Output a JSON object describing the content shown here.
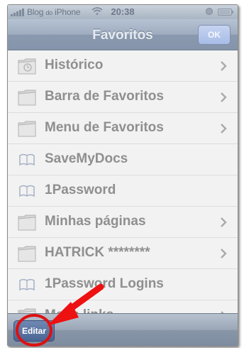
{
  "status": {
    "carrier": "Blog",
    "carrier_small": "do",
    "carrier_name": "iPhone",
    "time": "20:38"
  },
  "nav": {
    "title": "Favoritos",
    "ok_label": "OK"
  },
  "list": {
    "items": [
      {
        "label": "Histórico",
        "icon": "history-folder-icon",
        "chevron": true
      },
      {
        "label": "Barra de Favoritos",
        "icon": "folder-icon",
        "chevron": true
      },
      {
        "label": "Menu de Favoritos",
        "icon": "folder-icon",
        "chevron": true
      },
      {
        "label": "SaveMyDocs",
        "icon": "book-icon",
        "chevron": false
      },
      {
        "label": "1Password",
        "icon": "book-icon",
        "chevron": false
      },
      {
        "label": "Minhas páginas",
        "icon": "folder-icon",
        "chevron": true
      },
      {
        "label": "HATRICK ********",
        "icon": "folder-icon",
        "chevron": true
      },
      {
        "label": "1Password Logins",
        "icon": "book-icon",
        "chevron": false
      },
      {
        "label": "Meus links",
        "icon": "folder-icon",
        "chevron": true
      }
    ]
  },
  "toolbar": {
    "edit_label": "Editar"
  },
  "annotation": {
    "arrow_color": "#ee1111",
    "circle_color": "#dd1111"
  }
}
